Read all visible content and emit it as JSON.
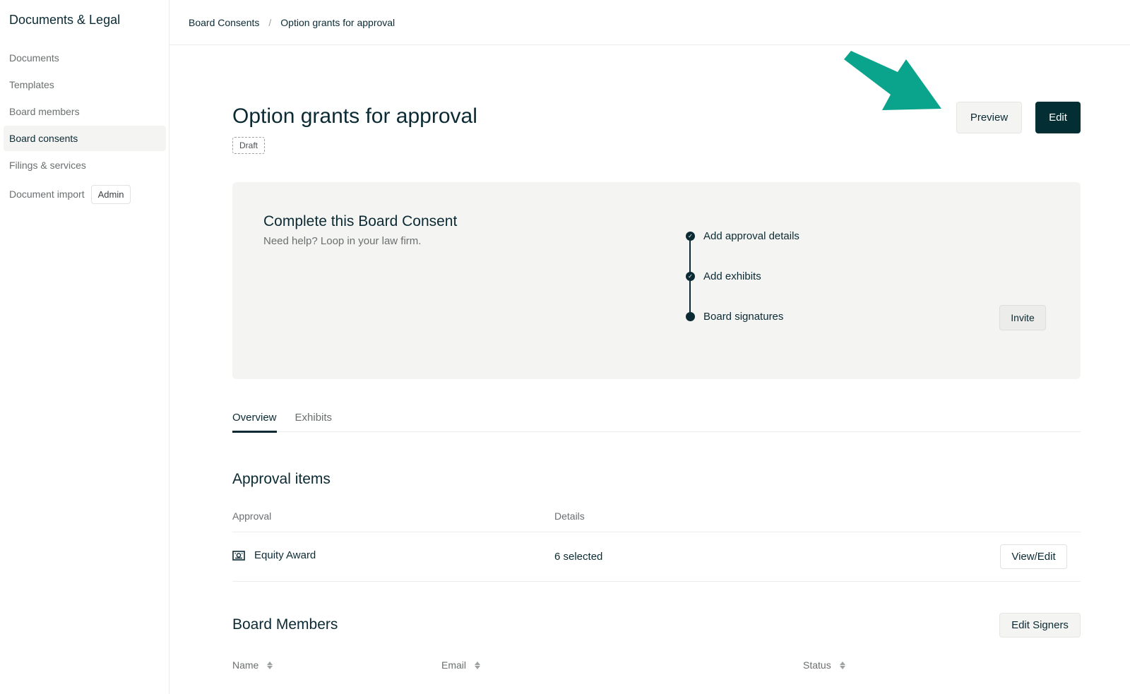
{
  "sidebar": {
    "title": "Documents & Legal",
    "items": [
      {
        "label": "Documents"
      },
      {
        "label": "Templates"
      },
      {
        "label": "Board members"
      },
      {
        "label": "Board consents"
      },
      {
        "label": "Filings & services"
      },
      {
        "label": "Document import"
      }
    ],
    "import_badge": "Admin"
  },
  "breadcrumb": {
    "parent": "Board Consents",
    "separator": "/",
    "current": "Option grants for approval"
  },
  "header": {
    "title": "Option grants for approval",
    "status": "Draft",
    "preview_label": "Preview",
    "edit_label": "Edit"
  },
  "consent_card": {
    "title": "Complete this Board Consent",
    "subtitle": "Need help? Loop in your law firm.",
    "steps": [
      {
        "label": "Add approval details",
        "done": true
      },
      {
        "label": "Add exhibits",
        "done": true
      },
      {
        "label": "Board signatures",
        "done": false
      }
    ],
    "invite_label": "Invite"
  },
  "tabs": [
    {
      "label": "Overview",
      "active": true
    },
    {
      "label": "Exhibits",
      "active": false
    }
  ],
  "approval_items": {
    "title": "Approval items",
    "columns": [
      "Approval",
      "Details"
    ],
    "rows": [
      {
        "approval": "Equity Award",
        "details": "6 selected",
        "action": "View/Edit"
      }
    ]
  },
  "board_members": {
    "title": "Board Members",
    "edit_signers_label": "Edit Signers",
    "columns": [
      "Name",
      "Email",
      "Status"
    ]
  },
  "colors": {
    "primary": "#032e33",
    "text": "#0b2a33",
    "muted": "#6b6f70",
    "card_bg": "#f4f4f2",
    "annotation_arrow": "#0aa38c"
  },
  "icons": {
    "approval_row": "certificate-icon",
    "step_done": "check-icon",
    "sort": "sort-icon",
    "annotation": "arrow-annotation-icon"
  }
}
